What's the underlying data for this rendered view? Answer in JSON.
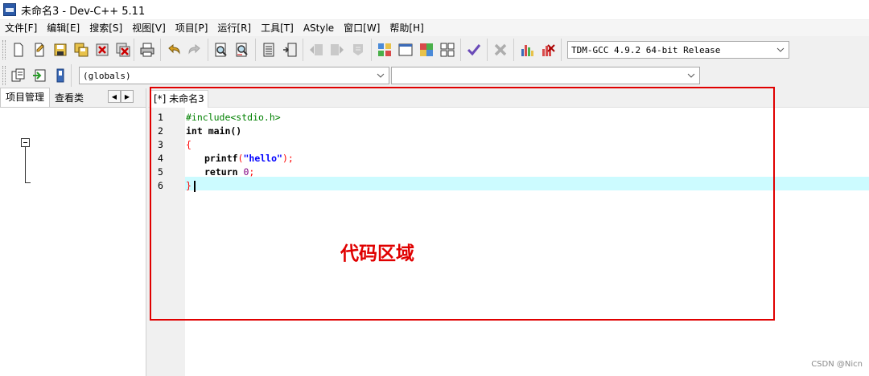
{
  "window": {
    "title": "未命名3 - Dev-C++ 5.11"
  },
  "menu": [
    "文件[F]",
    "编辑[E]",
    "搜索[S]",
    "视图[V]",
    "项目[P]",
    "运行[R]",
    "工具[T]",
    "AStyle",
    "窗口[W]",
    "帮助[H]"
  ],
  "toolbar": {
    "compiler_select": "TDM-GCC 4.9.2 64-bit Release",
    "scope_select": "(globals)",
    "member_select": ""
  },
  "left_panel": {
    "tabs": [
      "项目管理",
      "查看类"
    ]
  },
  "editor": {
    "tab_label": "[*] 未命名3",
    "lines": [
      {
        "number": "1",
        "text": "#include<stdio.h>"
      },
      {
        "number": "2",
        "text": "int main()"
      },
      {
        "number": "3",
        "text": "{"
      },
      {
        "number": "4",
        "text": "printf(\"hello\");"
      },
      {
        "number": "5",
        "text": "return 0;"
      },
      {
        "number": "6",
        "text": "}"
      }
    ]
  },
  "annotation": {
    "label": "代码区域",
    "color": "#e00000"
  },
  "watermark": "CSDN @Nicn",
  "colors": {
    "current_line": "#ccfbff",
    "preprocessor": "#008000",
    "string": "#0000ff",
    "brace": "#ff0000"
  }
}
